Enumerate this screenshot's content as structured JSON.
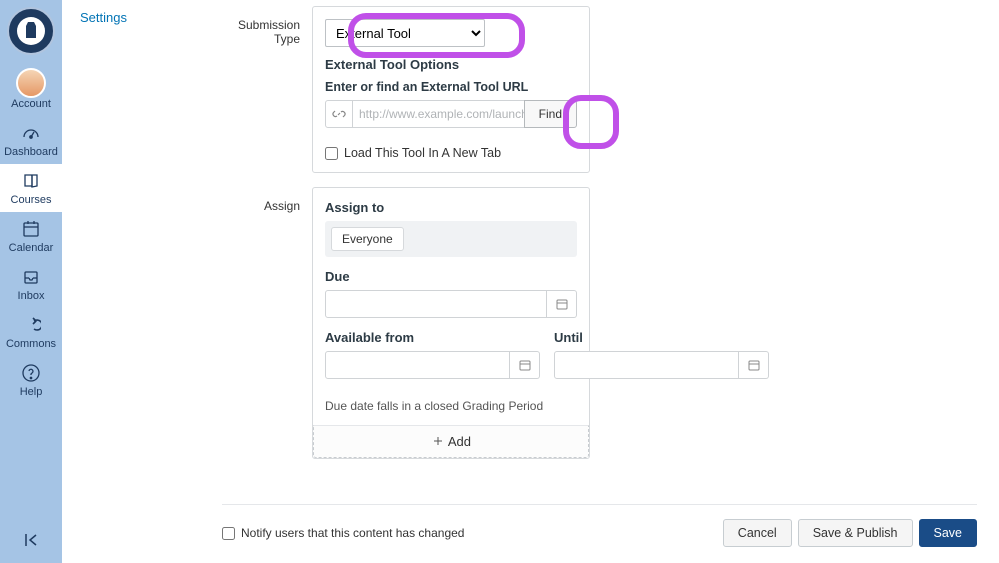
{
  "sidebar": {
    "items": [
      {
        "label": "Account"
      },
      {
        "label": "Dashboard"
      },
      {
        "label": "Courses"
      },
      {
        "label": "Calendar"
      },
      {
        "label": "Inbox"
      },
      {
        "label": "Commons"
      },
      {
        "label": "Help"
      }
    ]
  },
  "settings_link": "Settings",
  "submission": {
    "row_label": "Submission Type",
    "select_value": "External Tool",
    "options_heading": "External Tool Options",
    "url_label": "Enter or find an External Tool URL",
    "url_placeholder": "http://www.example.com/launch",
    "find_label": "Find",
    "new_tab_label": "Load This Tool In A New Tab"
  },
  "assign": {
    "row_label": "Assign",
    "assign_to_label": "Assign to",
    "assignee": "Everyone",
    "due_label": "Due",
    "available_from_label": "Available from",
    "until_label": "Until",
    "status_text": "Due date falls in a closed Grading Period",
    "add_label": "Add"
  },
  "footer": {
    "notify_label": "Notify users that this content has changed",
    "cancel": "Cancel",
    "save_publish": "Save & Publish",
    "save": "Save"
  }
}
